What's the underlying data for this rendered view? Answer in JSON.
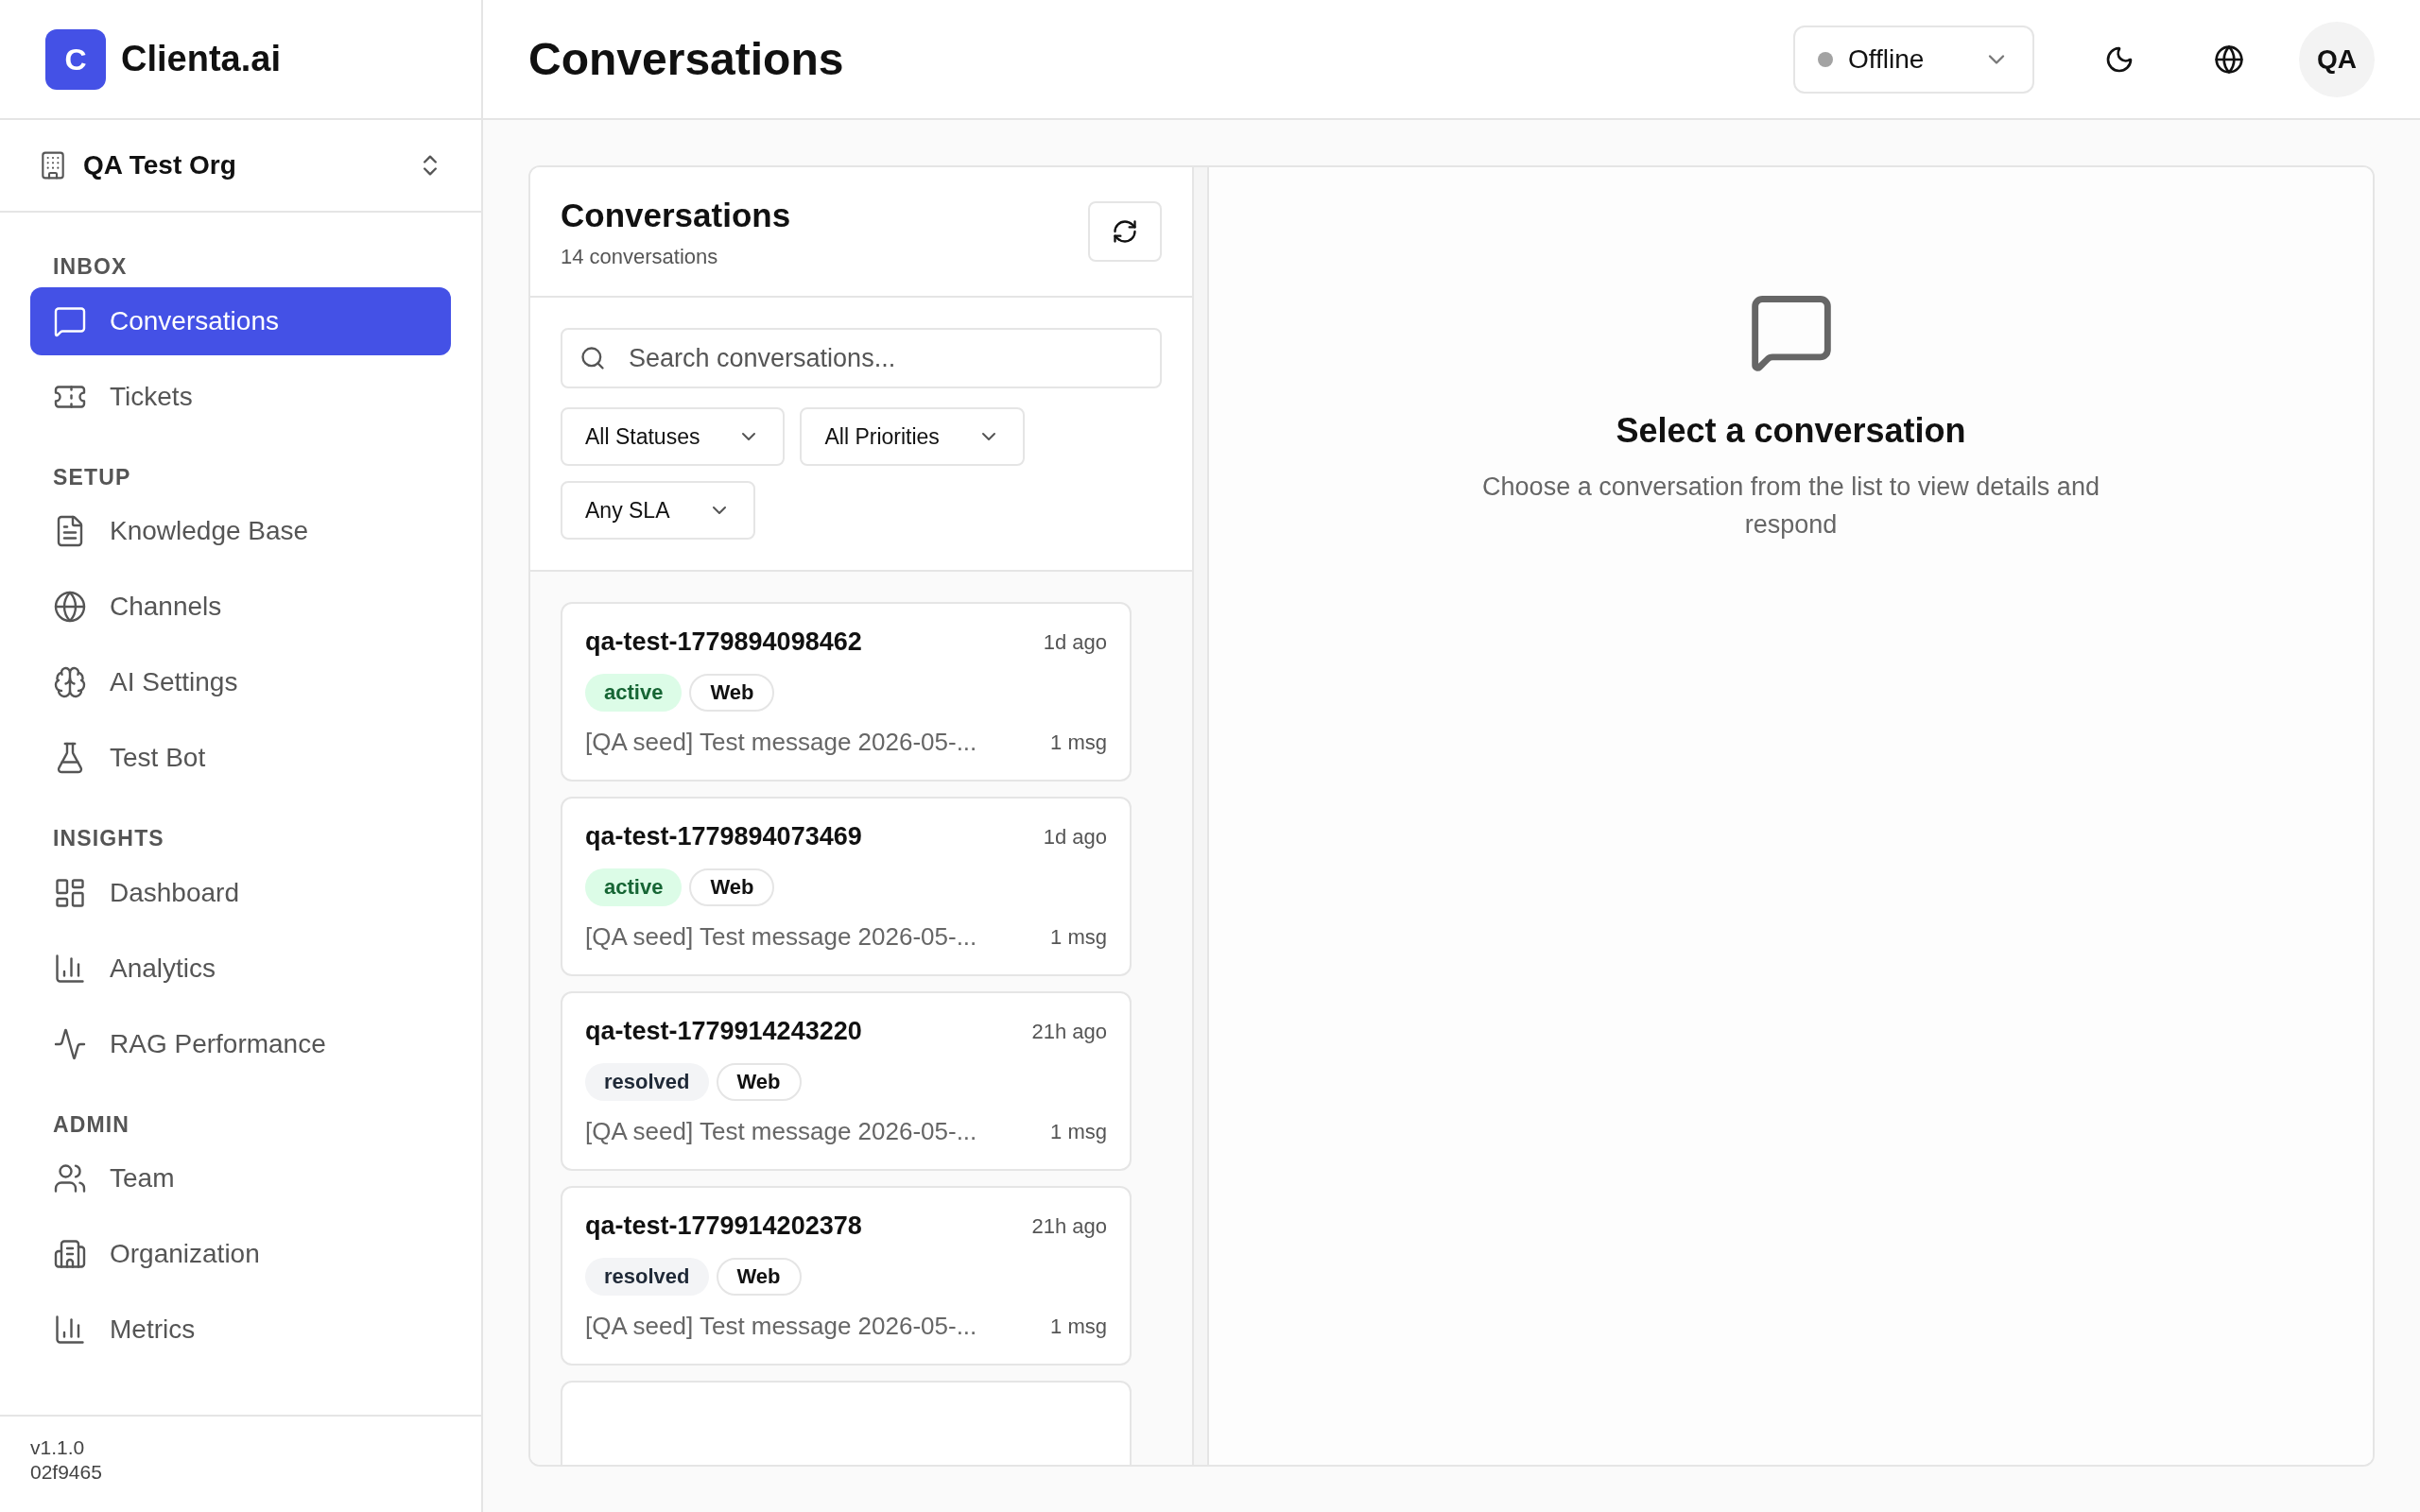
{
  "brand": {
    "logo_letter": "C",
    "name": "Clienta.ai"
  },
  "org_switcher": {
    "name": "QA Test Org"
  },
  "sidebar": {
    "sections": [
      {
        "title": "INBOX",
        "items": [
          {
            "label": "Conversations",
            "selected": true
          },
          {
            "label": "Tickets",
            "selected": false
          }
        ]
      },
      {
        "title": "SETUP",
        "items": [
          {
            "label": "Knowledge Base",
            "selected": false
          },
          {
            "label": "Channels",
            "selected": false
          },
          {
            "label": "AI Settings",
            "selected": false
          },
          {
            "label": "Test Bot",
            "selected": false
          }
        ]
      },
      {
        "title": "INSIGHTS",
        "items": [
          {
            "label": "Dashboard",
            "selected": false
          },
          {
            "label": "Analytics",
            "selected": false
          },
          {
            "label": "RAG Performance",
            "selected": false
          }
        ]
      },
      {
        "title": "ADMIN",
        "items": [
          {
            "label": "Team",
            "selected": false
          },
          {
            "label": "Organization",
            "selected": false
          },
          {
            "label": "Metrics",
            "selected": false
          }
        ]
      }
    ],
    "footer": {
      "version": "v1.1.0",
      "build": "02f9465"
    }
  },
  "header": {
    "title": "Conversations",
    "status": {
      "label": "Offline",
      "color": "#a3a3a3"
    },
    "avatar": "QA"
  },
  "list_panel": {
    "title": "Conversations",
    "count": "14 conversations",
    "search": {
      "placeholder": "Search conversations..."
    },
    "filters": [
      "All Statuses",
      "All Priorities",
      "Any SLA"
    ],
    "conversations": [
      {
        "id": "qa-test-1779894098462",
        "time": "1d ago",
        "status": {
          "label": "active",
          "kind": "success"
        },
        "channel": "Web",
        "preview": "[QA seed] Test message 2026-05-...",
        "messages": "1 msg"
      },
      {
        "id": "qa-test-1779894073469",
        "time": "1d ago",
        "status": {
          "label": "active",
          "kind": "success"
        },
        "channel": "Web",
        "preview": "[QA seed] Test message 2026-05-...",
        "messages": "1 msg"
      },
      {
        "id": "qa-test-1779914243220",
        "time": "21h ago",
        "status": {
          "label": "resolved",
          "kind": "neutral"
        },
        "channel": "Web",
        "preview": "[QA seed] Test message 2026-05-...",
        "messages": "1 msg"
      },
      {
        "id": "qa-test-1779914202378",
        "time": "21h ago",
        "status": {
          "label": "resolved",
          "kind": "neutral"
        },
        "channel": "Web",
        "preview": "[QA seed] Test message 2026-05-...",
        "messages": "1 msg"
      }
    ]
  },
  "detail_panel": {
    "title": "Select a conversation",
    "description": "Choose a conversation from the list to view details and respond"
  }
}
